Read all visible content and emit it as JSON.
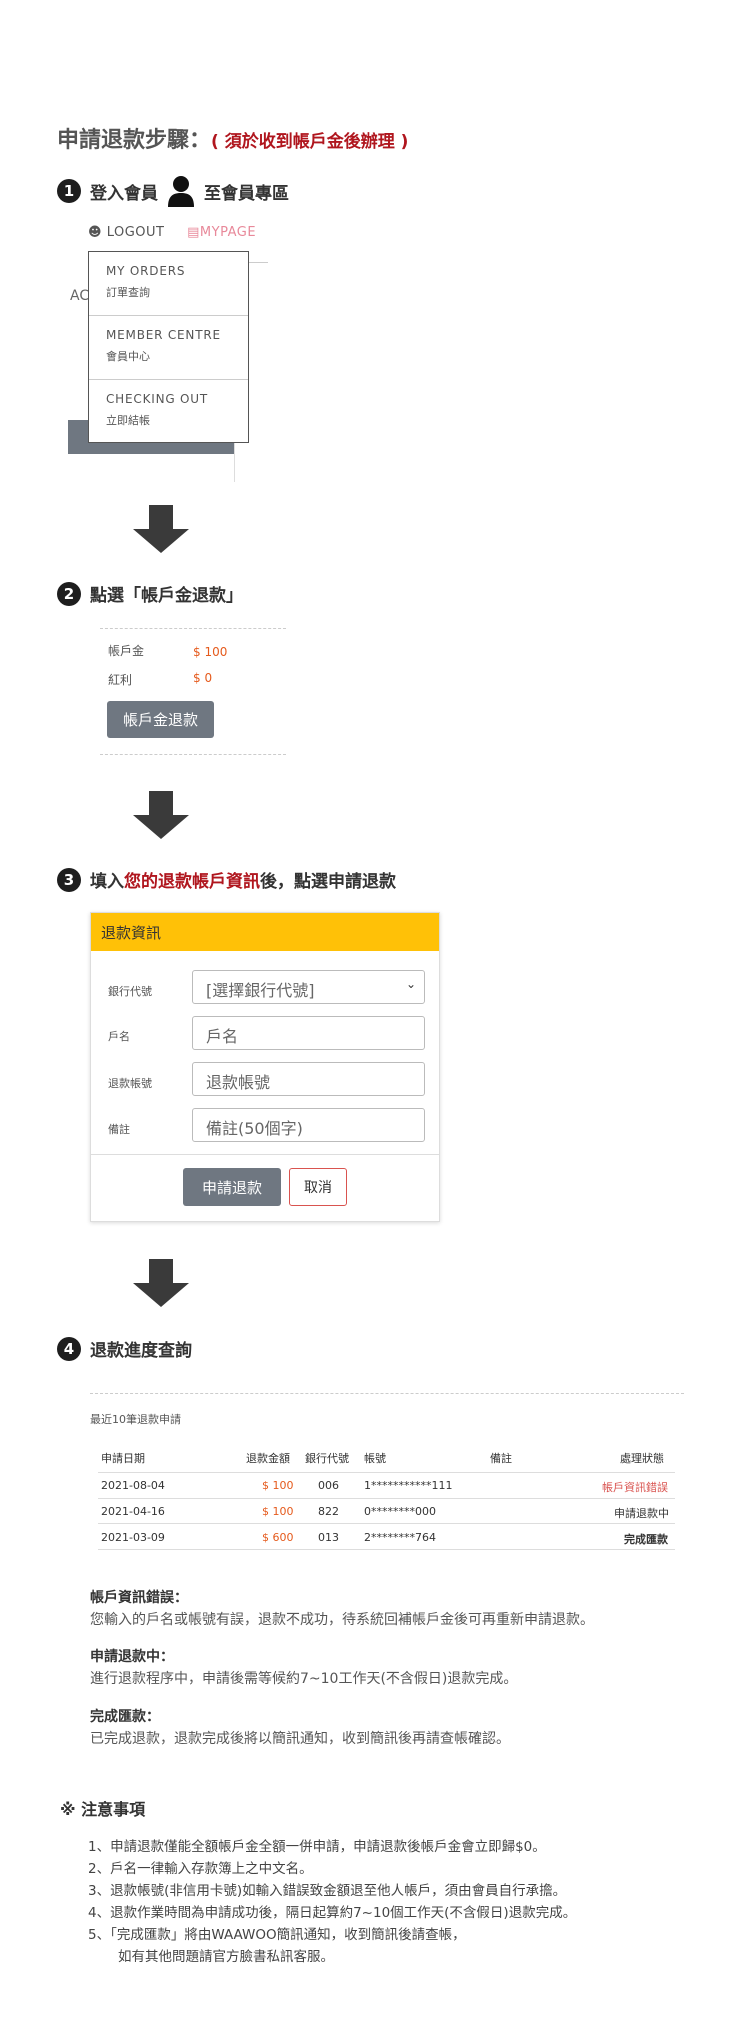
{
  "title": {
    "main": "申請退款步驟：",
    "note": "( 須於收到帳戶金後辦理 )"
  },
  "step1": {
    "num": "1",
    "label_before": "登入會員",
    "label_after": "至會員專區",
    "nav_logout": "LOGOUT",
    "nav_mypage": "MYPAGE",
    "ac_text": "AC",
    "menu": [
      {
        "en": "MY ORDERS",
        "zh": "訂單查詢"
      },
      {
        "en": "MEMBER CENTRE",
        "zh": "會員中心"
      },
      {
        "en": "CHECKING OUT",
        "zh": "立即結帳"
      }
    ]
  },
  "step2": {
    "num": "2",
    "label": "點選「帳戶金退款」",
    "balance_label": "帳戶金",
    "balance_value": "$ 100",
    "bonus_label": "紅利",
    "bonus_value": "$ 0",
    "button": "帳戶金退款"
  },
  "step3": {
    "num": "3",
    "label_a": "填入",
    "label_b": "您的退款帳戶資訊",
    "label_c": "後，點選申請退款",
    "form": {
      "header": "退款資訊",
      "bank_label": "銀行代號",
      "bank_select": "[選擇銀行代號]",
      "name_label": "戶名",
      "name_placeholder": "戶名",
      "account_label": "退款帳號",
      "account_placeholder": "退款帳號",
      "memo_label": "備註",
      "memo_placeholder": "備註(50個字)",
      "submit": "申請退款",
      "cancel": "取消"
    }
  },
  "step4": {
    "num": "4",
    "label": "退款進度查詢",
    "recent": "最近10筆退款申請",
    "columns": [
      "申請日期",
      "退款金額",
      "銀行代號",
      "帳號",
      "備註",
      "處理狀態"
    ],
    "rows": [
      {
        "date": "2021-08-04",
        "amount": "$ 100",
        "bank": "006",
        "account": "1***********111",
        "memo": "",
        "status": "帳戶資訊錯誤"
      },
      {
        "date": "2021-04-16",
        "amount": "$ 100",
        "bank": "822",
        "account": "0********000",
        "memo": "",
        "status": "申請退款中"
      },
      {
        "date": "2021-03-09",
        "amount": "$ 600",
        "bank": "013",
        "account": "2********764",
        "memo": "",
        "status": "完成匯款"
      }
    ]
  },
  "legend": [
    {
      "title": "帳戶資訊錯誤：",
      "text": "您輸入的戶名或帳號有誤，退款不成功，待系統回補帳戶金後可再重新申請退款。"
    },
    {
      "title": "申請退款中：",
      "text": "進行退款程序中，申請後需等候約7~10工作天(不含假日)退款完成。"
    },
    {
      "title": "完成匯款：",
      "text": "已完成退款，退款完成後將以簡訊通知，收到簡訊後再請查帳確認。"
    }
  ],
  "notes": {
    "title": "※  注意事項",
    "items": [
      "1、申請退款僅能全額帳戶金全額一併申請，申請退款後帳戶金會立即歸$0。",
      "2、戶名一律輸入存款簿上之中文名。",
      "3、退款帳號(非信用卡號)如輸入錯誤致金額退至他人帳戶，須由會員自行承擔。",
      "4、退款作業時間為申請成功後，隔日起算約7~10個工作天(不含假日)退款完成。",
      "5、「完成匯款」將由WAAWOO簡訊通知，收到簡訊後請查帳，",
      "如有其他問題請官方臉書私訊客服。"
    ]
  }
}
